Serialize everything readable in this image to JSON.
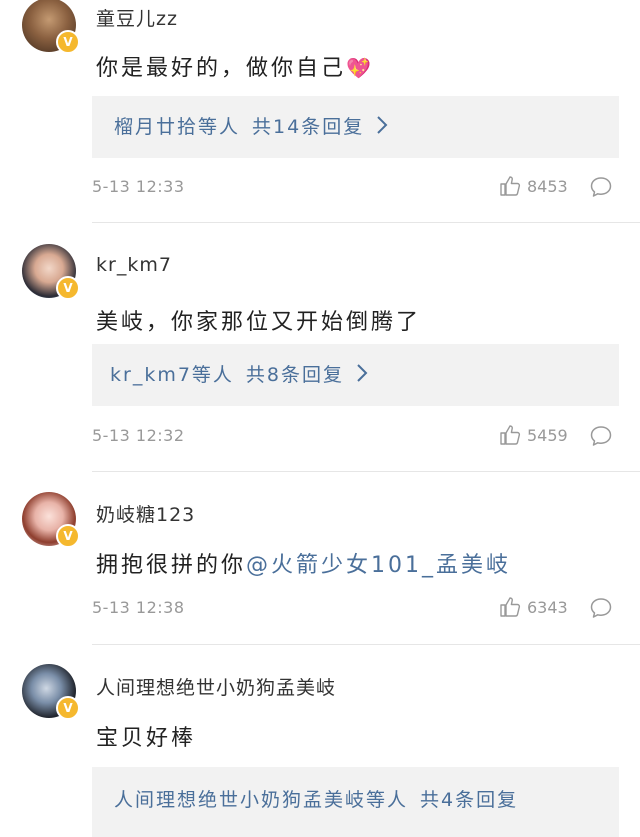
{
  "comments": [
    {
      "username": "童豆儿zz",
      "text": "你是最好的，做你自己",
      "emoji": "💖",
      "reply_summary": {
        "names": "榴月廿拾等人",
        "count_label": "共14条回复"
      },
      "time": "5-13 12:33",
      "likes": "8453"
    },
    {
      "username": "kr_km7",
      "text": "美岐，你家那位又开始倒腾了",
      "reply_summary": {
        "names": "kr_km7等人",
        "count_label": "共8条回复"
      },
      "time": "5-13 12:32",
      "likes": "5459"
    },
    {
      "username": "奶岐糖123",
      "text": "拥抱很拼的你",
      "mention": "@火箭少女101_孟美岐",
      "time": "5-13 12:38",
      "likes": "6343"
    },
    {
      "username": "人间理想绝世小奶狗孟美岐",
      "text": "宝贝好棒",
      "reply_summary": {
        "names": "人间理想绝世小奶狗孟美岐等人",
        "count_label": "共4条回复"
      }
    }
  ],
  "icons": {
    "like": "thumbs-up-icon",
    "reply": "speech-bubble-icon",
    "verified": "verified-v-badge-icon",
    "chevron": "chevron-right-icon"
  },
  "colors": {
    "link": "#4a6f9a",
    "badge": "#f5b82e",
    "meta": "#999999"
  }
}
